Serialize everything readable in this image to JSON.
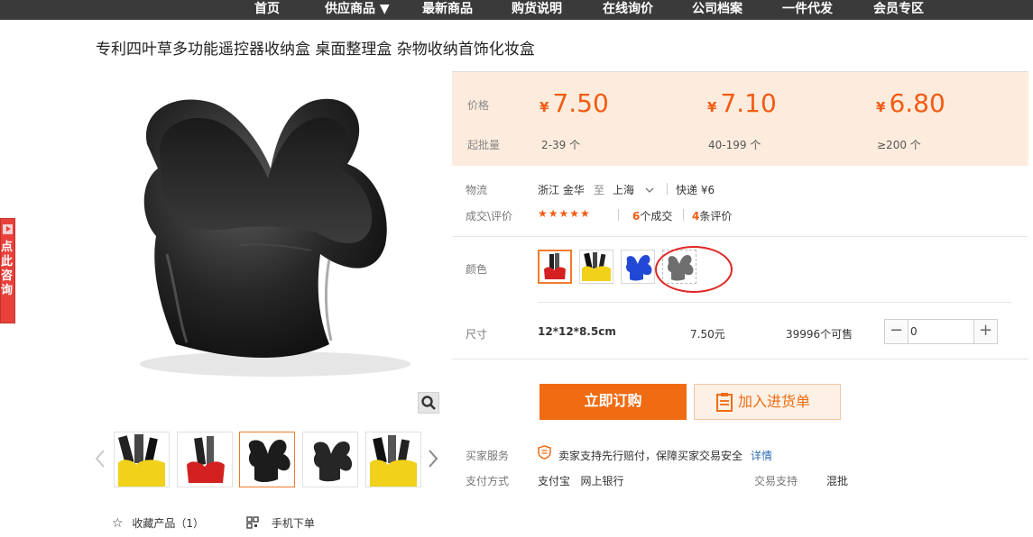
{
  "nav": {
    "items": [
      "首页",
      "供应商品 ▼",
      "最新商品",
      "购货说明",
      "在线询价",
      "公司档案",
      "一件代发",
      "会员专区"
    ]
  },
  "product": {
    "title": "专利四叶草多功能遥控器收纳盒 桌面整理盒 杂物收纳首饰化妆盒"
  },
  "side_tab": {
    "text": "点此咨询"
  },
  "price": {
    "label": "价格",
    "moq_label": "起批量",
    "currency": "¥",
    "tiers": [
      {
        "price": "7.50",
        "range": "2-39 个"
      },
      {
        "price": "7.10",
        "range": "40-199 个"
      },
      {
        "price": "6.80",
        "range": "≥200 个"
      }
    ],
    "accent_color": "#f35b13"
  },
  "logistics": {
    "label": "物流",
    "from": "浙江 金华",
    "to_word": "至",
    "to": "上海",
    "shipping": "快递 ¥6"
  },
  "reviews": {
    "label": "成交\\评价",
    "stars": "★★★★★",
    "deals_count": "6",
    "deals_suffix": "个成交",
    "reviews_count": "4",
    "reviews_suffix": "条评价"
  },
  "color": {
    "label": "颜色",
    "options": [
      "red",
      "yellow",
      "blue",
      "gray"
    ],
    "selected": "red"
  },
  "size": {
    "label": "尺寸",
    "value": "12*12*8.5cm",
    "price": "7.50元",
    "stock": "39996个可售",
    "quantity": "0",
    "minus": "−",
    "plus": "+"
  },
  "actions": {
    "buy_label": "立即订购",
    "cart_label": "加入进货单"
  },
  "service": {
    "label": "买家服务",
    "text": "卖家支持先行赔付，保障买家交易安全",
    "details_link": "详情"
  },
  "payment": {
    "label": "支付方式",
    "methods": "支付宝   网上银行",
    "trade_label": "交易支持",
    "trade_value": "混批"
  },
  "bottom": {
    "favorite": "收藏产品（1）",
    "mobile_order": "手机下单"
  }
}
